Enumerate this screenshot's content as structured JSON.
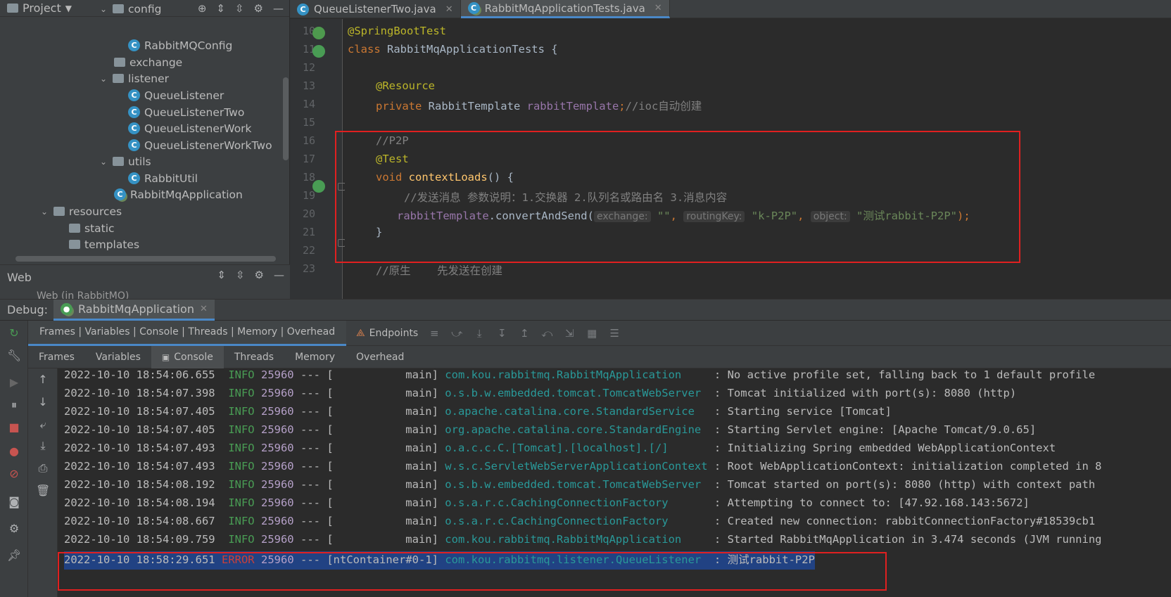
{
  "project": {
    "title": "Project",
    "items": [
      {
        "label": "config",
        "type": "folder",
        "chev": "v"
      },
      {
        "label": "RabbitMQConfig",
        "type": "class"
      },
      {
        "label": "exchange",
        "type": "folder",
        "chev": ""
      },
      {
        "label": "listener",
        "type": "folder",
        "chev": "v"
      },
      {
        "label": "QueueListener",
        "type": "class"
      },
      {
        "label": "QueueListenerTwo",
        "type": "class"
      },
      {
        "label": "QueueListenerWork",
        "type": "class"
      },
      {
        "label": "QueueListenerWorkTwo",
        "type": "class"
      },
      {
        "label": "utils",
        "type": "folder",
        "chev": "v"
      },
      {
        "label": "RabbitUtil",
        "type": "class"
      },
      {
        "label": "RabbitMqApplication",
        "type": "spring-class"
      },
      {
        "label": "resources",
        "type": "resources-folder",
        "chev": "v"
      },
      {
        "label": "static",
        "type": "folder"
      },
      {
        "label": "templates",
        "type": "folder"
      }
    ]
  },
  "web_panel": {
    "title": "Web",
    "item": "Web (in RabbitMQ)"
  },
  "editor": {
    "tabs": [
      {
        "label": "QueueListenerTwo.java",
        "active": false
      },
      {
        "label": "RabbitMqApplicationTests.java",
        "active": true
      }
    ],
    "line_numbers": [
      "10",
      "11",
      "12",
      "13",
      "14",
      "15",
      "16",
      "17",
      "18",
      "19",
      "20",
      "21",
      "22",
      "23"
    ],
    "code": {
      "l10": "@SpringBootTest",
      "l11_kw": "class ",
      "l11_rest": "RabbitMqApplicationTests {",
      "l13": "@Resource",
      "l14_kw": "private ",
      "l14_type": "RabbitTemplate ",
      "l14_field": "rabbitTemplate",
      "l14_rest": ";",
      "l14_cmt": "//ioc自动创建",
      "l16": "//P2P",
      "l17": "@Test",
      "l18_kw": "void ",
      "l18_fn": "contextLoads",
      "l18_rest": "() {",
      "l19": "//发送消息 参数说明：1.交换器 2.队列名或路由名 3.消息内容",
      "l20_field": "rabbitTemplate",
      "l20_call": ".convertAndSend(",
      "l20_hint1": "exchange:",
      "l20_arg1": "\"\"",
      "l20_sep": ",",
      "l20_hint2": "routingKey:",
      "l20_arg2": "\"k-P2P\"",
      "l20_hint3": "object:",
      "l20_arg3": "\"测试rabbit-P2P\"",
      "l20_end": ");",
      "l21": "}",
      "l23": "//原生    先发送在创建"
    }
  },
  "debug": {
    "label": "Debug:",
    "session_tab": "RabbitMqApplication",
    "layout_tab": "Frames | Variables | Console | Threads | Memory | Overhead",
    "endpoints": "Endpoints",
    "subtabs": [
      "Frames",
      "Variables",
      "Console",
      "Threads",
      "Memory",
      "Overhead"
    ],
    "active_subtab": "Console"
  },
  "console_log": [
    {
      "ts": "2022-10-10 18:54:06.655",
      "level": "INFO",
      "pid": "25960",
      "sep": " --- [",
      "thread": "           main] ",
      "logger": "com.kou.rabbitmq.RabbitMqApplication     ",
      "msg": ": No active profile set, falling back to 1 default profile"
    },
    {
      "ts": "2022-10-10 18:54:07.398",
      "level": "INFO",
      "pid": "25960",
      "sep": " --- [",
      "thread": "           main] ",
      "logger": "o.s.b.w.embedded.tomcat.TomcatWebServer  ",
      "msg": ": Tomcat initialized with port(s): 8080 (http)"
    },
    {
      "ts": "2022-10-10 18:54:07.405",
      "level": "INFO",
      "pid": "25960",
      "sep": " --- [",
      "thread": "           main] ",
      "logger": "o.apache.catalina.core.StandardService   ",
      "msg": ": Starting service [Tomcat]"
    },
    {
      "ts": "2022-10-10 18:54:07.405",
      "level": "INFO",
      "pid": "25960",
      "sep": " --- [",
      "thread": "           main] ",
      "logger": "org.apache.catalina.core.StandardEngine  ",
      "msg": ": Starting Servlet engine: [Apache Tomcat/9.0.65]"
    },
    {
      "ts": "2022-10-10 18:54:07.493",
      "level": "INFO",
      "pid": "25960",
      "sep": " --- [",
      "thread": "           main] ",
      "logger": "o.a.c.c.C.[Tomcat].[localhost].[/]       ",
      "msg": ": Initializing Spring embedded WebApplicationContext"
    },
    {
      "ts": "2022-10-10 18:54:07.493",
      "level": "INFO",
      "pid": "25960",
      "sep": " --- [",
      "thread": "           main] ",
      "logger": "w.s.c.ServletWebServerApplicationContext ",
      "msg": ": Root WebApplicationContext: initialization completed in 8"
    },
    {
      "ts": "2022-10-10 18:54:08.192",
      "level": "INFO",
      "pid": "25960",
      "sep": " --- [",
      "thread": "           main] ",
      "logger": "o.s.b.w.embedded.tomcat.TomcatWebServer  ",
      "msg": ": Tomcat started on port(s): 8080 (http) with context path"
    },
    {
      "ts": "2022-10-10 18:54:08.194",
      "level": "INFO",
      "pid": "25960",
      "sep": " --- [",
      "thread": "           main] ",
      "logger": "o.s.a.r.c.CachingConnectionFactory       ",
      "msg": ": Attempting to connect to: [47.92.168.143:5672]"
    },
    {
      "ts": "2022-10-10 18:54:08.667",
      "level": "INFO",
      "pid": "25960",
      "sep": " --- [",
      "thread": "           main] ",
      "logger": "o.s.a.r.c.CachingConnectionFactory       ",
      "msg": ": Created new connection: rabbitConnectionFactory#18539cb1"
    },
    {
      "ts": "2022-10-10 18:54:09.759",
      "level": "INFO",
      "pid": "25960",
      "sep": " --- [",
      "thread": "           main] ",
      "logger": "com.kou.rabbitmq.RabbitMqApplication     ",
      "msg": ": Started RabbitMqApplication in 3.474 seconds (JVM running"
    },
    {
      "ts": "2022-10-10 18:58:29.651",
      "level": "ERROR",
      "pid": "25960",
      "sep": " --- [",
      "thread": "ntContainer#0-1] ",
      "logger": "com.kou.rabbitmq.listener.QueueListener  ",
      "msg": ": 测试rabbit-P2P"
    }
  ]
}
